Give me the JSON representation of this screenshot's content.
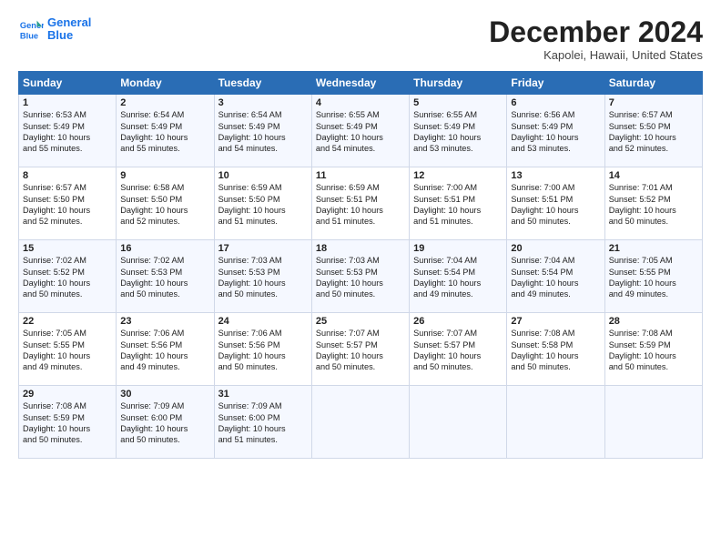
{
  "header": {
    "logo_line1": "General",
    "logo_line2": "Blue",
    "month": "December 2024",
    "location": "Kapolei, Hawaii, United States"
  },
  "days_of_week": [
    "Sunday",
    "Monday",
    "Tuesday",
    "Wednesday",
    "Thursday",
    "Friday",
    "Saturday"
  ],
  "weeks": [
    [
      {
        "day": "1",
        "text": "Sunrise: 6:53 AM\nSunset: 5:49 PM\nDaylight: 10 hours\nand 55 minutes."
      },
      {
        "day": "2",
        "text": "Sunrise: 6:54 AM\nSunset: 5:49 PM\nDaylight: 10 hours\nand 55 minutes."
      },
      {
        "day": "3",
        "text": "Sunrise: 6:54 AM\nSunset: 5:49 PM\nDaylight: 10 hours\nand 54 minutes."
      },
      {
        "day": "4",
        "text": "Sunrise: 6:55 AM\nSunset: 5:49 PM\nDaylight: 10 hours\nand 54 minutes."
      },
      {
        "day": "5",
        "text": "Sunrise: 6:55 AM\nSunset: 5:49 PM\nDaylight: 10 hours\nand 53 minutes."
      },
      {
        "day": "6",
        "text": "Sunrise: 6:56 AM\nSunset: 5:49 PM\nDaylight: 10 hours\nand 53 minutes."
      },
      {
        "day": "7",
        "text": "Sunrise: 6:57 AM\nSunset: 5:50 PM\nDaylight: 10 hours\nand 52 minutes."
      }
    ],
    [
      {
        "day": "8",
        "text": "Sunrise: 6:57 AM\nSunset: 5:50 PM\nDaylight: 10 hours\nand 52 minutes."
      },
      {
        "day": "9",
        "text": "Sunrise: 6:58 AM\nSunset: 5:50 PM\nDaylight: 10 hours\nand 52 minutes."
      },
      {
        "day": "10",
        "text": "Sunrise: 6:59 AM\nSunset: 5:50 PM\nDaylight: 10 hours\nand 51 minutes."
      },
      {
        "day": "11",
        "text": "Sunrise: 6:59 AM\nSunset: 5:51 PM\nDaylight: 10 hours\nand 51 minutes."
      },
      {
        "day": "12",
        "text": "Sunrise: 7:00 AM\nSunset: 5:51 PM\nDaylight: 10 hours\nand 51 minutes."
      },
      {
        "day": "13",
        "text": "Sunrise: 7:00 AM\nSunset: 5:51 PM\nDaylight: 10 hours\nand 50 minutes."
      },
      {
        "day": "14",
        "text": "Sunrise: 7:01 AM\nSunset: 5:52 PM\nDaylight: 10 hours\nand 50 minutes."
      }
    ],
    [
      {
        "day": "15",
        "text": "Sunrise: 7:02 AM\nSunset: 5:52 PM\nDaylight: 10 hours\nand 50 minutes."
      },
      {
        "day": "16",
        "text": "Sunrise: 7:02 AM\nSunset: 5:53 PM\nDaylight: 10 hours\nand 50 minutes."
      },
      {
        "day": "17",
        "text": "Sunrise: 7:03 AM\nSunset: 5:53 PM\nDaylight: 10 hours\nand 50 minutes."
      },
      {
        "day": "18",
        "text": "Sunrise: 7:03 AM\nSunset: 5:53 PM\nDaylight: 10 hours\nand 50 minutes."
      },
      {
        "day": "19",
        "text": "Sunrise: 7:04 AM\nSunset: 5:54 PM\nDaylight: 10 hours\nand 49 minutes."
      },
      {
        "day": "20",
        "text": "Sunrise: 7:04 AM\nSunset: 5:54 PM\nDaylight: 10 hours\nand 49 minutes."
      },
      {
        "day": "21",
        "text": "Sunrise: 7:05 AM\nSunset: 5:55 PM\nDaylight: 10 hours\nand 49 minutes."
      }
    ],
    [
      {
        "day": "22",
        "text": "Sunrise: 7:05 AM\nSunset: 5:55 PM\nDaylight: 10 hours\nand 49 minutes."
      },
      {
        "day": "23",
        "text": "Sunrise: 7:06 AM\nSunset: 5:56 PM\nDaylight: 10 hours\nand 49 minutes."
      },
      {
        "day": "24",
        "text": "Sunrise: 7:06 AM\nSunset: 5:56 PM\nDaylight: 10 hours\nand 50 minutes."
      },
      {
        "day": "25",
        "text": "Sunrise: 7:07 AM\nSunset: 5:57 PM\nDaylight: 10 hours\nand 50 minutes."
      },
      {
        "day": "26",
        "text": "Sunrise: 7:07 AM\nSunset: 5:57 PM\nDaylight: 10 hours\nand 50 minutes."
      },
      {
        "day": "27",
        "text": "Sunrise: 7:08 AM\nSunset: 5:58 PM\nDaylight: 10 hours\nand 50 minutes."
      },
      {
        "day": "28",
        "text": "Sunrise: 7:08 AM\nSunset: 5:59 PM\nDaylight: 10 hours\nand 50 minutes."
      }
    ],
    [
      {
        "day": "29",
        "text": "Sunrise: 7:08 AM\nSunset: 5:59 PM\nDaylight: 10 hours\nand 50 minutes."
      },
      {
        "day": "30",
        "text": "Sunrise: 7:09 AM\nSunset: 6:00 PM\nDaylight: 10 hours\nand 50 minutes."
      },
      {
        "day": "31",
        "text": "Sunrise: 7:09 AM\nSunset: 6:00 PM\nDaylight: 10 hours\nand 51 minutes."
      },
      {
        "day": "",
        "text": ""
      },
      {
        "day": "",
        "text": ""
      },
      {
        "day": "",
        "text": ""
      },
      {
        "day": "",
        "text": ""
      }
    ]
  ]
}
